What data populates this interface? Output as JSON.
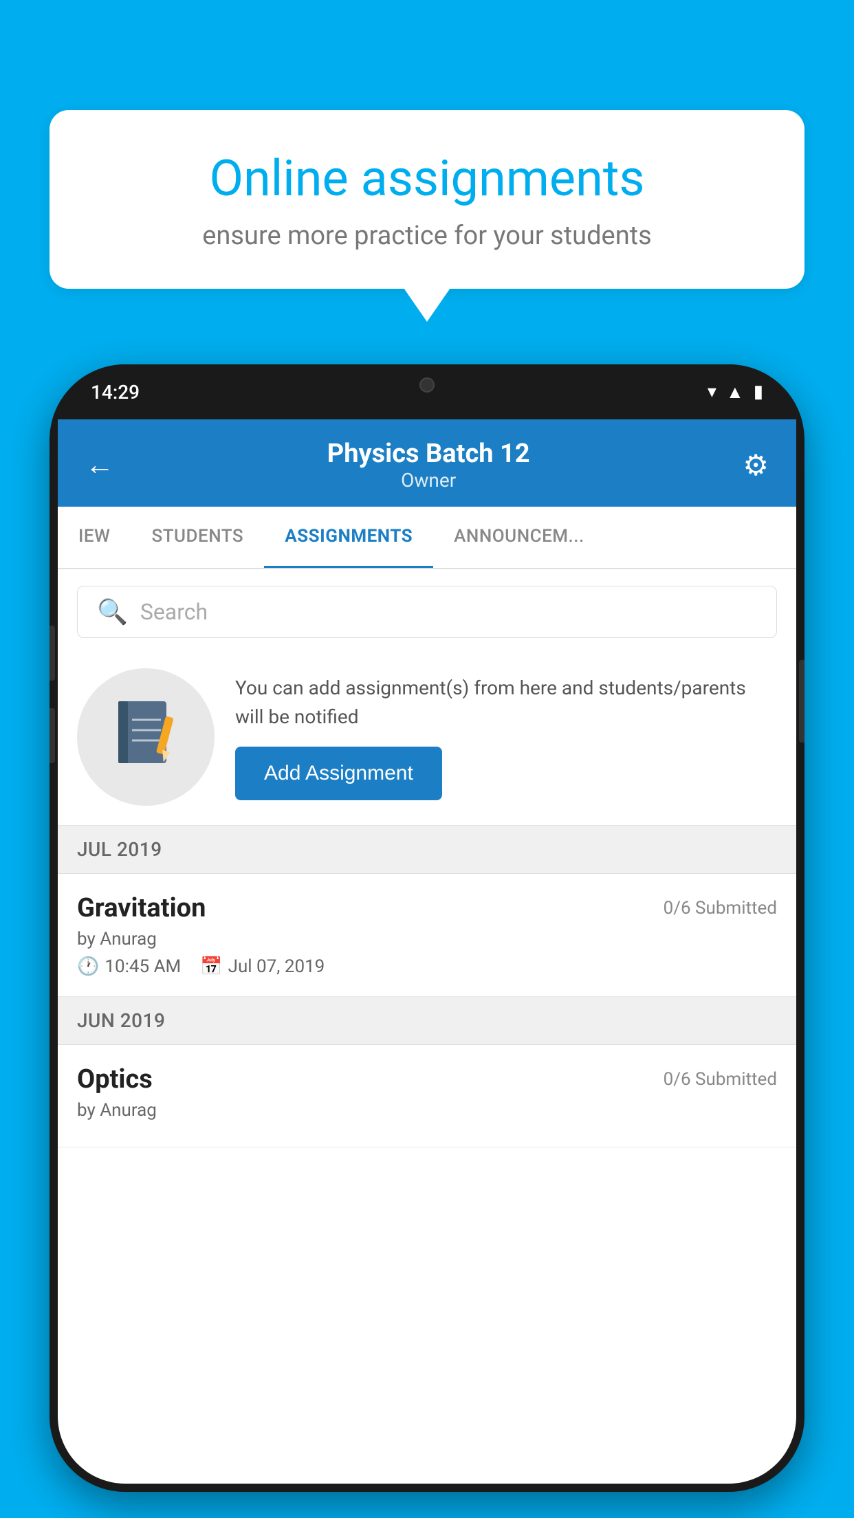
{
  "background_color": "#00AEEF",
  "speech_bubble": {
    "title": "Online assignments",
    "subtitle": "ensure more practice for your students"
  },
  "phone": {
    "status_bar": {
      "time": "14:29"
    },
    "header": {
      "title": "Physics Batch 12",
      "subtitle": "Owner",
      "back_label": "←",
      "settings_label": "⚙"
    },
    "tabs": [
      {
        "label": "IEW",
        "active": false
      },
      {
        "label": "STUDENTS",
        "active": false
      },
      {
        "label": "ASSIGNMENTS",
        "active": true
      },
      {
        "label": "ANNOUNCEM...",
        "active": false
      }
    ],
    "search": {
      "placeholder": "Search"
    },
    "promo": {
      "text": "You can add assignment(s) from here and students/parents will be notified",
      "button_label": "Add Assignment"
    },
    "sections": [
      {
        "month": "JUL 2019",
        "assignments": [
          {
            "name": "Gravitation",
            "submitted": "0/6 Submitted",
            "by": "by Anurag",
            "time": "10:45 AM",
            "date": "Jul 07, 2019"
          }
        ]
      },
      {
        "month": "JUN 2019",
        "assignments": [
          {
            "name": "Optics",
            "submitted": "0/6 Submitted",
            "by": "by Anurag",
            "time": "",
            "date": ""
          }
        ]
      }
    ]
  }
}
